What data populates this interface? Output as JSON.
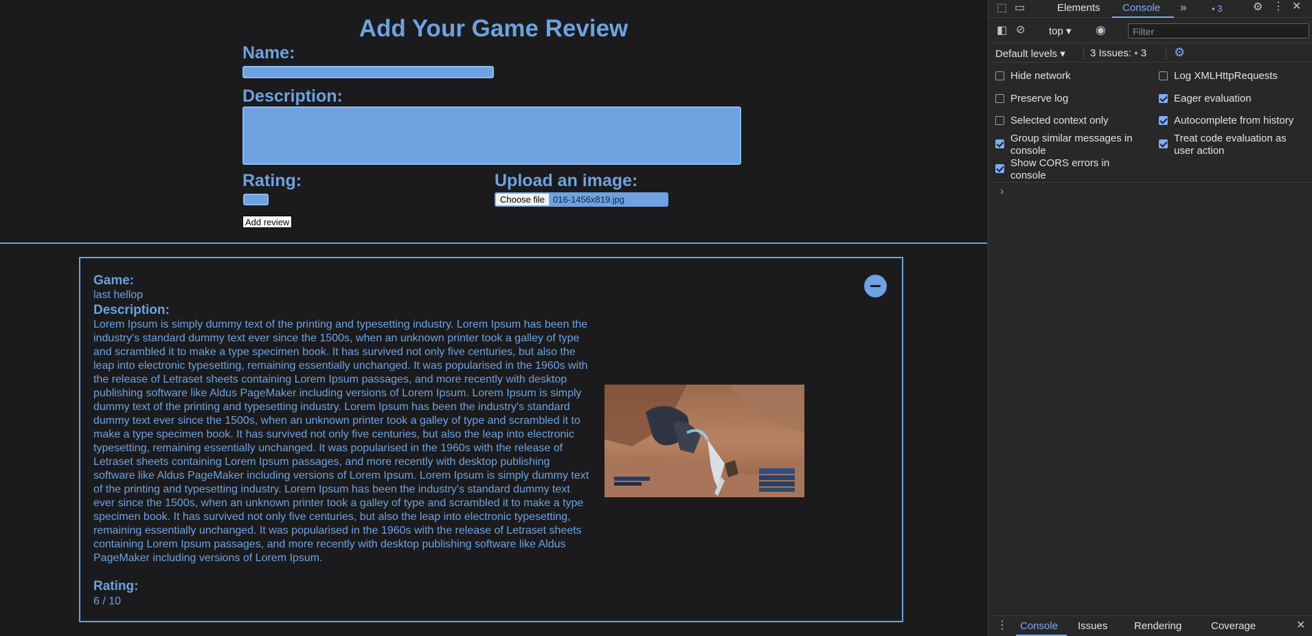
{
  "form": {
    "title": "Add Your Game Review",
    "name_label": "Name:",
    "name_value": "",
    "description_label": "Description:",
    "description_value": "",
    "rating_label": "Rating:",
    "rating_value": "",
    "upload_label": "Upload an image:",
    "choose_file_label": "Choose file",
    "file_name": "016-1456x819.jpg",
    "submit_label": "Add review"
  },
  "review": {
    "game_heading": "Game:",
    "game_name": "last hellop",
    "description_heading": "Description:",
    "description": "Lorem Ipsum is simply dummy text of the printing and typesetting industry. Lorem Ipsum has been the industry's standard dummy text ever since the 1500s, when an unknown printer took a galley of type and scrambled it to make a type specimen book. It has survived not only five centuries, but also the leap into electronic typesetting, remaining essentially unchanged. It was popularised in the 1960s with the release of Letraset sheets containing Lorem Ipsum passages, and more recently with desktop publishing software like Aldus PageMaker including versions of Lorem Ipsum. Lorem Ipsum is simply dummy text of the printing and typesetting industry. Lorem Ipsum has been the industry's standard dummy text ever since the 1500s, when an unknown printer took a galley of type and scrambled it to make a type specimen book. It has survived not only five centuries, but also the leap into electronic typesetting, remaining essentially unchanged. It was popularised in the 1960s with the release of Letraset sheets containing Lorem Ipsum passages, and more recently with desktop publishing software like Aldus PageMaker including versions of Lorem Ipsum. Lorem Ipsum is simply dummy text of the printing and typesetting industry. Lorem Ipsum has been the industry's standard dummy text ever since the 1500s, when an unknown printer took a galley of type and scrambled it to make a type specimen book. It has survived not only five centuries, but also the leap into electronic typesetting, remaining essentially unchanged. It was popularised in the 1960s with the release of Letraset sheets containing Lorem Ipsum passages, and more recently with desktop publishing software like Aldus PageMaker including versions of Lorem Ipsum.",
    "rating_heading": "Rating:",
    "rating": "6 / 10"
  },
  "devtools": {
    "tabs": [
      "Elements",
      "Console"
    ],
    "active_tab": "Console",
    "issues_badge": "3",
    "context": "top",
    "filter_placeholder": "Filter",
    "levels": "Default levels",
    "issues_label": "3 Issues:",
    "issues_count": "3",
    "settings": [
      {
        "label": "Hide network",
        "checked": false
      },
      {
        "label": "Log XMLHttpRequests",
        "checked": false
      },
      {
        "label": "Preserve log",
        "checked": false
      },
      {
        "label": "Eager evaluation",
        "checked": true
      },
      {
        "label": "Selected context only",
        "checked": false
      },
      {
        "label": "Autocomplete from history",
        "checked": true
      },
      {
        "label": "Group similar messages in console",
        "checked": true
      },
      {
        "label": "Treat code evaluation as user action",
        "checked": true
      },
      {
        "label": "Show CORS errors in console",
        "checked": true
      }
    ],
    "drawer_tabs": [
      "Console",
      "Issues",
      "Rendering",
      "Coverage"
    ],
    "active_drawer_tab": "Console",
    "accent": "#7cacf8"
  },
  "colors": {
    "page_bg": "#1b1b1d",
    "accent": "#6ea2e0"
  }
}
